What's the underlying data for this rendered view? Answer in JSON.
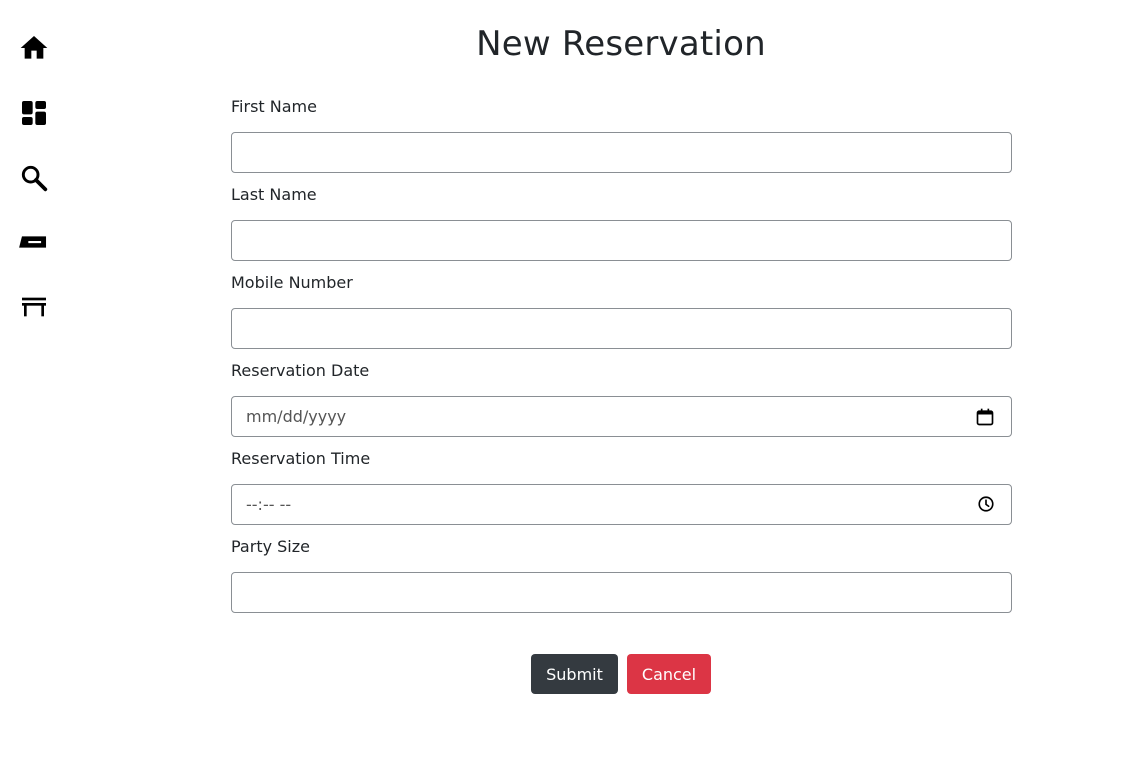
{
  "sidebar": {
    "items": [
      {
        "icon": "home-icon"
      },
      {
        "icon": "dashboard-icon"
      },
      {
        "icon": "search-icon"
      },
      {
        "icon": "ticket-icon"
      },
      {
        "icon": "table-icon"
      }
    ]
  },
  "page": {
    "title": "New Reservation"
  },
  "form": {
    "first_name": {
      "label": "First Name",
      "value": ""
    },
    "last_name": {
      "label": "Last Name",
      "value": ""
    },
    "mobile": {
      "label": "Mobile Number",
      "value": ""
    },
    "date": {
      "label": "Reservation Date",
      "placeholder": "mm/dd/yyyy"
    },
    "time": {
      "label": "Reservation Time",
      "placeholder": "--:-- --"
    },
    "party_size": {
      "label": "Party Size",
      "value": ""
    }
  },
  "buttons": {
    "submit": "Submit",
    "cancel": "Cancel"
  },
  "colors": {
    "submit_bg": "#343a40",
    "cancel_bg": "#dc3545",
    "input_border": "#8a8f94"
  }
}
